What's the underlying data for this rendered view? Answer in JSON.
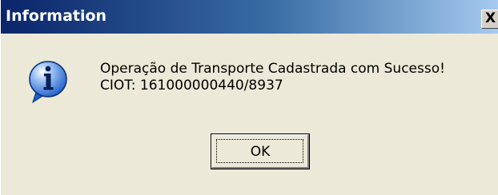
{
  "dialog": {
    "title": "Information",
    "close_glyph": "X",
    "icon": "information-icon",
    "message_line1": "Operação de Transporte Cadastrada com Sucesso!",
    "message_line2": "CIOT: 161000000440/8937",
    "ok_label": "OK"
  },
  "colors": {
    "title_bar_start": "#0a246a",
    "title_bar_end": "#a6caf0",
    "dialog_background": "#ece9d8",
    "icon_blue": "#1f5fc9"
  }
}
